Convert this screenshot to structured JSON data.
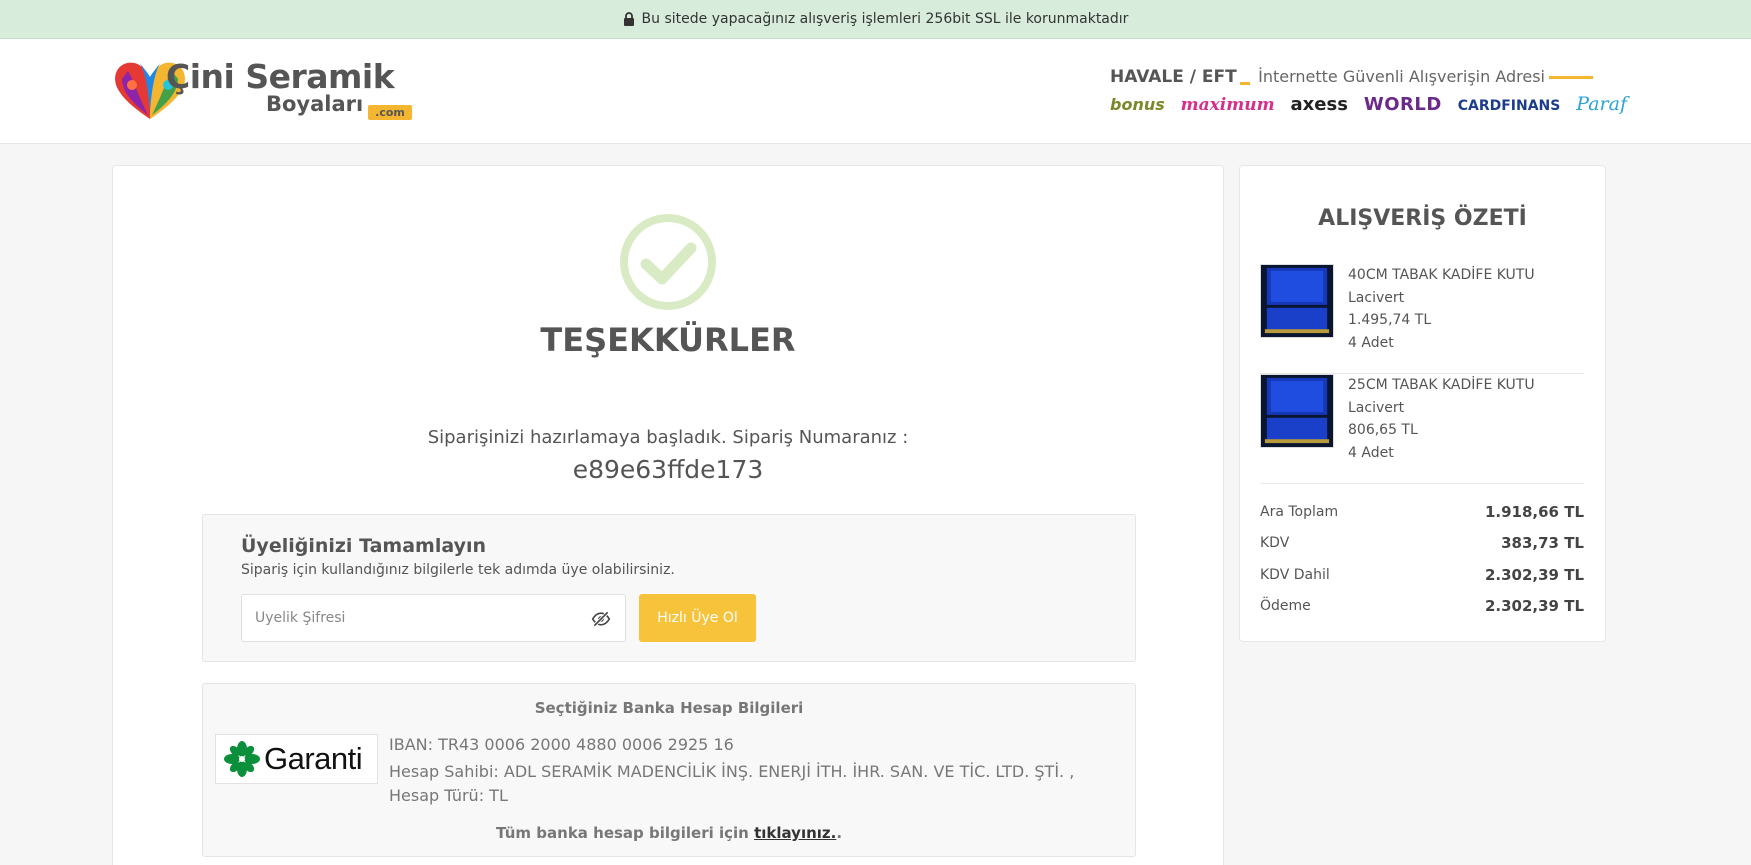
{
  "ssl_bar": {
    "text": "Bu sitede yapacağınız alışveriş işlemleri 256bit SSL ile korunmaktadır",
    "icon": "lock-icon"
  },
  "header": {
    "logo": {
      "line1": "Çini Seramik",
      "line2": "Boyaları",
      "com": ".com"
    },
    "payment": {
      "havale": "HAVALE / EFT",
      "slogan": "İnternette Güvenli Alışverişin Adresi",
      "cards": [
        "bonus",
        "maximum",
        "axess",
        "WORLD",
        "CARDFINANS",
        "Paraf"
      ]
    }
  },
  "confirmation": {
    "title": "TEŞEKKÜRLER",
    "message": "Siparişinizi hazırlamaya başladık. Sipariş Numaranız :",
    "order_number": "e89e63ffde173",
    "check_color": "#d9ebc4"
  },
  "membership": {
    "title": "Üyeliğinizi Tamamlayın",
    "subtitle": "Sipariş için kullandığınız bilgilerle tek adımda üye olabilirsiniz.",
    "password_placeholder": "Üyelik Şifresi",
    "button_label": "Hızlı Üye Ol",
    "button_color": "#f7c33a"
  },
  "bank": {
    "title": "Seçtiğiniz Banka Hesap Bilgileri",
    "bank_name": "Garanti",
    "iban": "IBAN: TR43 0006 2000 4880 0006 2925 16",
    "holder": "Hesap Sahibi: ADL SERAMİK MADENCİLİK İNŞ. ENERJİ İTH. İHR. SAN. VE TİC. LTD. ŞTİ. , Hesap Türü: TL",
    "footer_prefix": "Tüm banka hesap bilgileri için",
    "footer_link": "tıklayınız.",
    "footer_suffix": "."
  },
  "summary": {
    "title": "ALIŞVERİŞ ÖZETİ",
    "items": [
      {
        "name": "40CM TABAK KADİFE KUTU",
        "color": "Lacivert",
        "price": "1.495,74 TL",
        "qty": "4 Adet"
      },
      {
        "name": "25CM TABAK KADİFE KUTU",
        "color": "Lacivert",
        "price": "806,65 TL",
        "qty": "4 Adet"
      }
    ],
    "totals": [
      {
        "label": "Ara Toplam",
        "value": "1.918,66 TL"
      },
      {
        "label": "KDV",
        "value": "383,73 TL"
      },
      {
        "label": "KDV Dahil",
        "value": "2.302,39 TL"
      },
      {
        "label": "Ödeme",
        "value": "2.302,39 TL"
      }
    ]
  }
}
